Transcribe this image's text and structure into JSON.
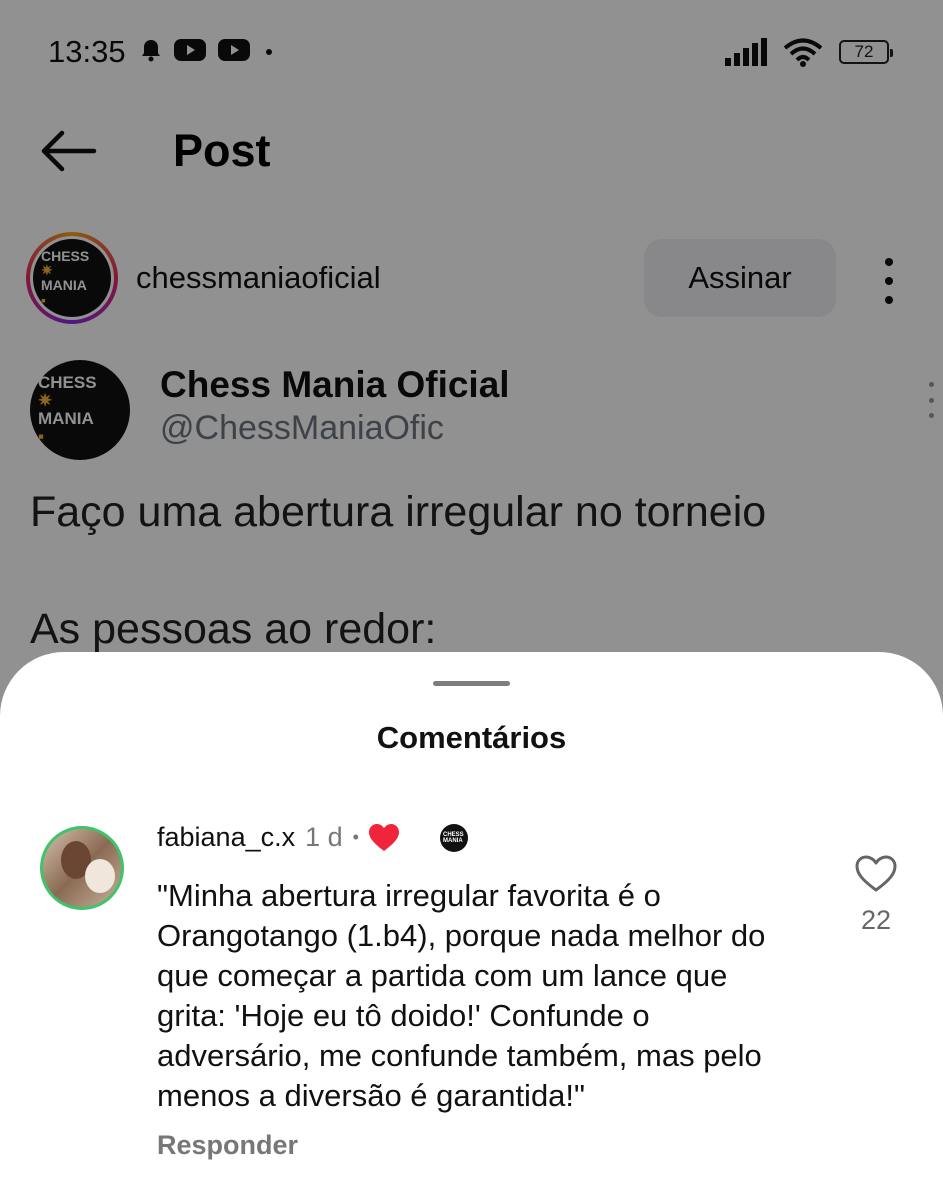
{
  "status_bar": {
    "time": "13:35",
    "battery": "72",
    "icons": [
      "bell-icon",
      "youtube-icon",
      "youtube-icon",
      "dot-icon",
      "signal-icon",
      "wifi-icon",
      "battery-icon"
    ]
  },
  "header": {
    "title": "Post",
    "back_icon": "arrow-left-icon"
  },
  "account": {
    "username": "chessmaniaoficial",
    "logo_text_1": "CHESS",
    "logo_text_2": "MANIA",
    "subscribe_label": "Assinar",
    "menu_icon": "more-vertical-icon"
  },
  "tweet": {
    "name": "Chess Mania Oficial",
    "handle": "@ChessManiaOfic",
    "line1": "Faço uma abertura irregular no torneio",
    "line2": "As pessoas ao redor:"
  },
  "comments_sheet": {
    "title": "Comentários",
    "comments": [
      {
        "user": "fabiana_c.x",
        "time": "1 d",
        "separator": "•",
        "text": "\"Minha abertura irregular favorita é o Orangotango (1.b4), porque nada melhor do que começar a partida com um lance que grita: 'Hoje eu tô doido!' Confunde o adversário, me confunde também, mas pelo menos a diversão é garantida!\"",
        "reply_label": "Responder",
        "likes": "22"
      }
    ]
  },
  "colors": {
    "overlay": "#000000",
    "liked_heart": "#f0243a",
    "subscribe_bg": "#eff0f2",
    "handle_gray": "#6b7580",
    "avatar_ring": "#3ec46a"
  }
}
